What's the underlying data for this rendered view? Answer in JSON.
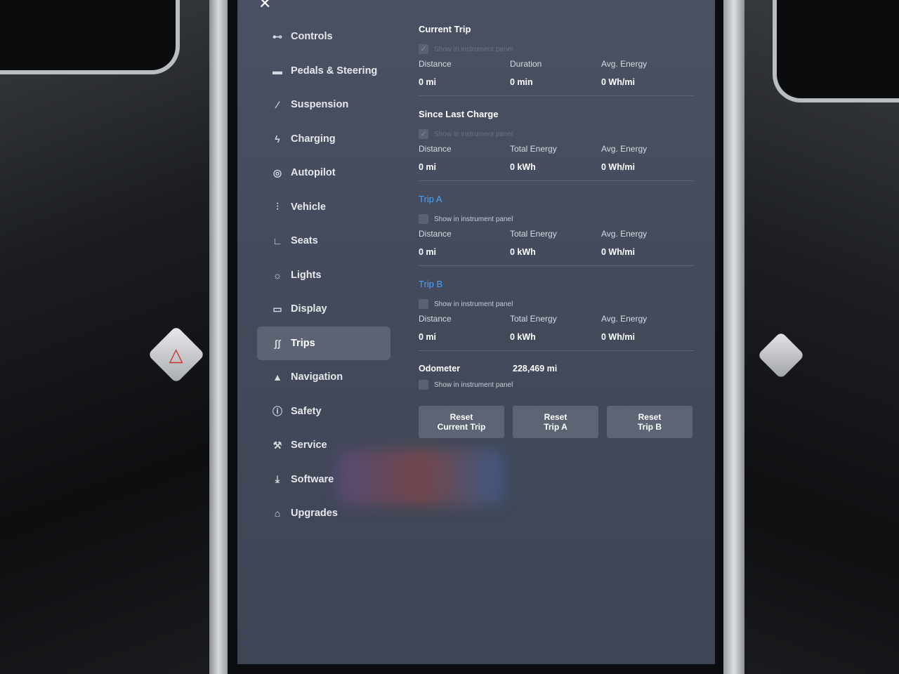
{
  "sidebar": {
    "items": [
      {
        "label": "Controls",
        "icon": "toggle-icon"
      },
      {
        "label": "Pedals & Steering",
        "icon": "car-icon"
      },
      {
        "label": "Suspension",
        "icon": "suspension-icon"
      },
      {
        "label": "Charging",
        "icon": "bolt-icon"
      },
      {
        "label": "Autopilot",
        "icon": "steering-wheel-icon"
      },
      {
        "label": "Vehicle",
        "icon": "vehicle-sliders-icon"
      },
      {
        "label": "Seats",
        "icon": "seat-icon"
      },
      {
        "label": "Lights",
        "icon": "sun-icon"
      },
      {
        "label": "Display",
        "icon": "display-icon"
      },
      {
        "label": "Trips",
        "icon": "trips-icon"
      },
      {
        "label": "Navigation",
        "icon": "navigation-arrow-icon"
      },
      {
        "label": "Safety",
        "icon": "alert-circle-icon"
      },
      {
        "label": "Service",
        "icon": "wrench-icon"
      },
      {
        "label": "Software",
        "icon": "download-icon"
      },
      {
        "label": "Upgrades",
        "icon": "bag-icon"
      }
    ],
    "active": "Trips"
  },
  "current_trip": {
    "title": "Current Trip",
    "show_label": "Show in instrument panel",
    "stats": [
      {
        "label": "Distance",
        "value": "0  mi"
      },
      {
        "label": "Duration",
        "value": "0  min"
      },
      {
        "label": "Avg. Energy",
        "value": "0  Wh/mi"
      }
    ]
  },
  "since_last_charge": {
    "title": "Since Last Charge",
    "show_label": "Show in instrument panel",
    "stats": [
      {
        "label": "Distance",
        "value": "0  mi"
      },
      {
        "label": "Total Energy",
        "value": "0  kWh"
      },
      {
        "label": "Avg. Energy",
        "value": "0  Wh/mi"
      }
    ]
  },
  "trip_a": {
    "title": "Trip A",
    "show_label": "Show in instrument panel",
    "stats": [
      {
        "label": "Distance",
        "value": "0  mi"
      },
      {
        "label": "Total Energy",
        "value": "0  kWh"
      },
      {
        "label": "Avg. Energy",
        "value": "0  Wh/mi"
      }
    ]
  },
  "trip_b": {
    "title": "Trip B",
    "show_label": "Show in instrument panel",
    "stats": [
      {
        "label": "Distance",
        "value": "0  mi"
      },
      {
        "label": "Total Energy",
        "value": "0  kWh"
      },
      {
        "label": "Avg. Energy",
        "value": "0  Wh/mi"
      }
    ]
  },
  "odometer": {
    "label": "Odometer",
    "value": "228,469  mi",
    "show_label": "Show in instrument panel"
  },
  "buttons": {
    "reset_current": "Reset\nCurrent Trip",
    "reset_a": "Reset\nTrip A",
    "reset_b": "Reset\nTrip B"
  },
  "colors": {
    "screen_bg": "#444b5c",
    "accent_link": "#4aa3ff",
    "active_nav": "#5c6474",
    "button_bg": "#5d6575"
  }
}
